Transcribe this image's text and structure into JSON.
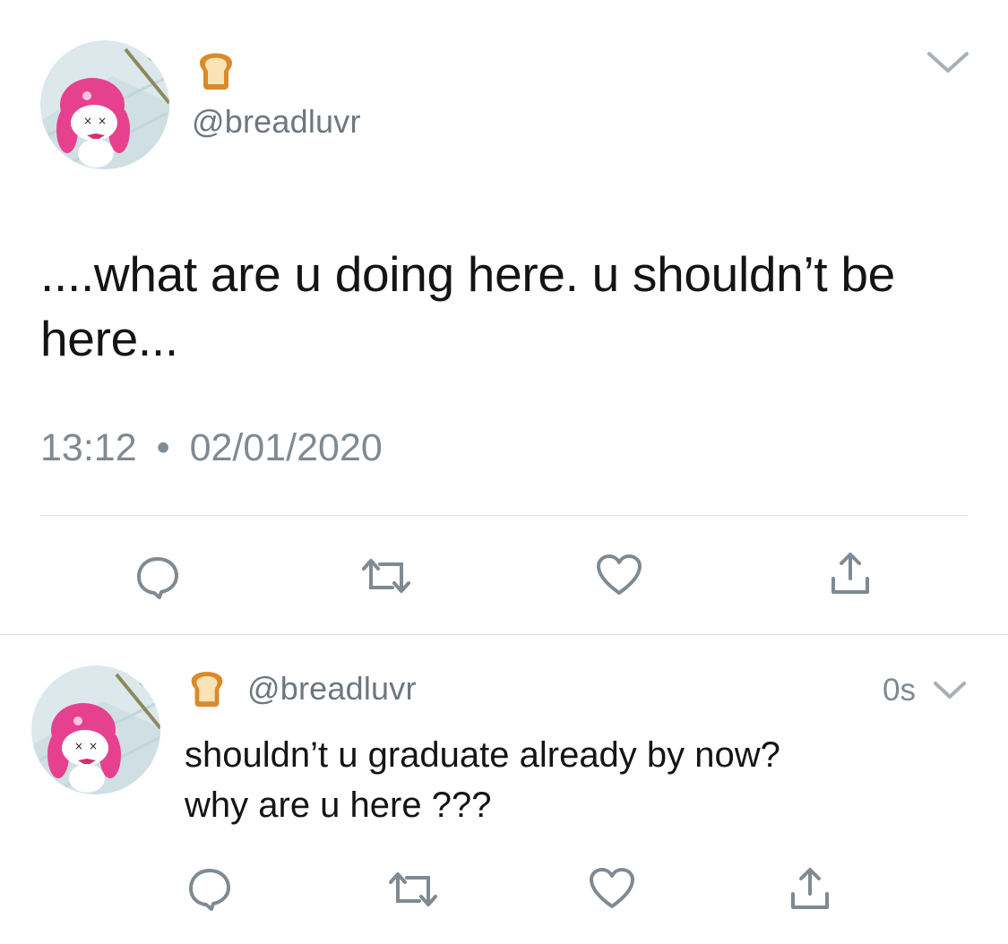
{
  "tweet": {
    "display_name_emoji": "bread-emoji",
    "handle": "@breadluvr",
    "text": "....what are u doing here. u shouldn’t be here...",
    "time": "13:12",
    "separator": "•",
    "date": "02/01/2020",
    "actions": [
      "reply-icon",
      "retweet-icon",
      "like-icon",
      "share-icon"
    ]
  },
  "reply": {
    "display_name_emoji": "bread-emoji",
    "handle": "@breadluvr",
    "timestamp": "0s",
    "text_line1": "shouldn’t u graduate already by now?",
    "text_line2": "why are u here ???",
    "actions": [
      "reply-icon",
      "retweet-icon",
      "like-icon",
      "share-icon"
    ]
  },
  "colors": {
    "icon_gray": "#7f8a93",
    "divider": "#dcdfe3",
    "avatar_bg": "#dbe7ea",
    "avatar_pink": "#e6418f"
  }
}
